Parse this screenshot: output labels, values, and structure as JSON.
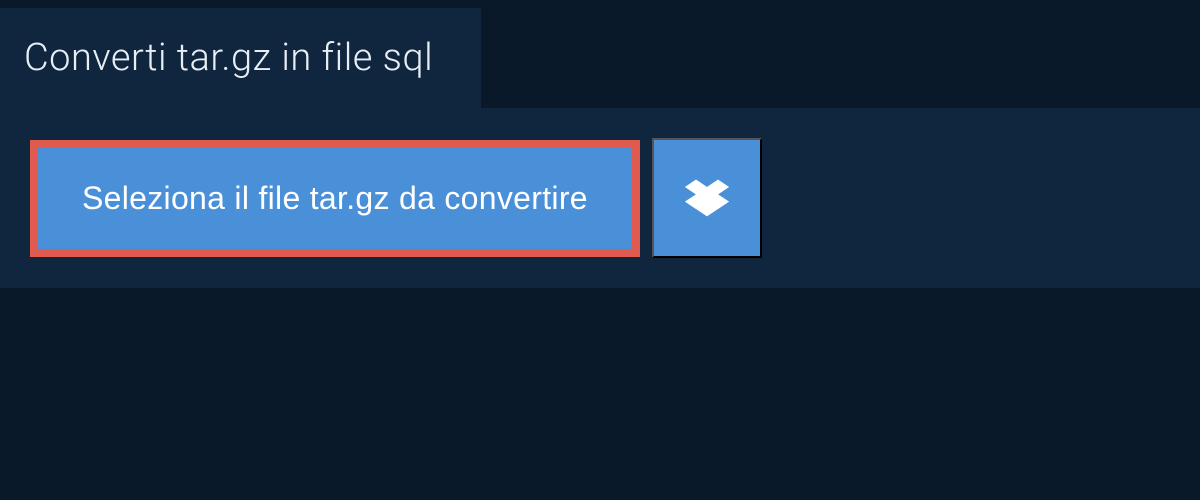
{
  "header": {
    "title": "Converti tar.gz in file sql"
  },
  "upload": {
    "select_button_label": "Seleziona il file tar.gz da convertire"
  },
  "colors": {
    "background": "#0a1929",
    "panel": "#10263f",
    "button_primary": "#4a90d9",
    "highlight_border": "#e05a4f",
    "text_light": "#e8eef5"
  }
}
